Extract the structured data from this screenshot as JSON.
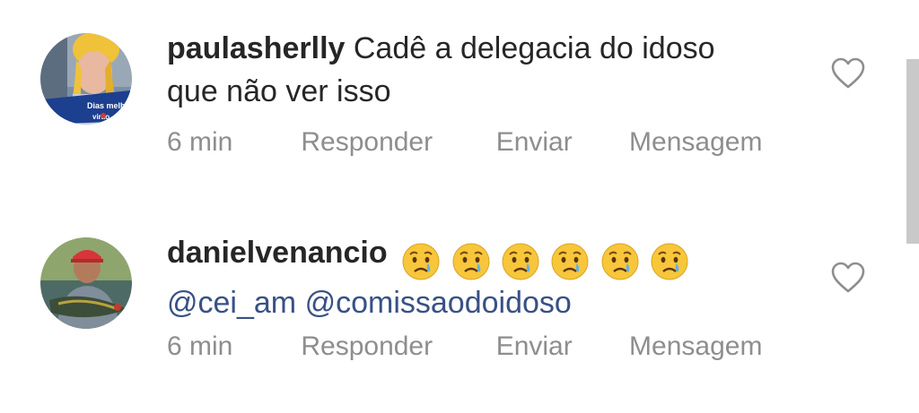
{
  "comments": [
    {
      "username": "paulasherlly",
      "text_line1": "Cadê a delegacia do idoso",
      "text_line2": "que não ver isso",
      "avatar_overlay_text": "Dias melhores virão",
      "time": "6 min",
      "reply_label": "Responder",
      "send_label": "Enviar",
      "message_label": "Mensagem",
      "like_icon": "heart-outline-icon"
    },
    {
      "username": "danielvenancio",
      "emoji": "crying-face",
      "emoji_count": 6,
      "mention1": "@cei_am",
      "mention2": "@comissaodoidoso",
      "time": "6 min",
      "reply_label": "Responder",
      "send_label": "Enviar",
      "message_label": "Mensagem",
      "like_icon": "heart-outline-icon"
    }
  ],
  "colors": {
    "text": "#262626",
    "secondary": "#8e8e8e",
    "mention": "#385185",
    "scrollbar": "#c9c9c9"
  }
}
